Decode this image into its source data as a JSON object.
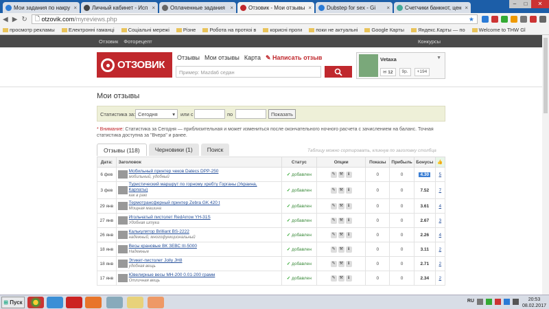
{
  "browser": {
    "tabs": [
      {
        "label": "Мои задания по накру",
        "color": "#2b7bd6",
        "active": false
      },
      {
        "label": "Личный кабинет - Исп",
        "color": "#444",
        "active": false
      },
      {
        "label": "Оплаченные задания",
        "color": "#666",
        "active": false
      },
      {
        "label": "Отзовик - Мои отзывы",
        "color": "#c0282d",
        "active": true
      },
      {
        "label": "Dubstep for sex - Gi",
        "color": "#2b7bd6",
        "active": false
      },
      {
        "label": "Счетчики банкнот, цен",
        "color": "#4a9",
        "active": false
      }
    ],
    "url_host": "otzovik.com",
    "url_path": "/myreviews.php",
    "bookmarks": [
      "просмотр рекламы",
      "Електронні гаманці",
      "Соціальні мережі",
      "Різне",
      "Робота на протязі в",
      "корисні проги",
      "поки не актуальні",
      "Google Карты",
      "Яндекс.Карты — по",
      "Welcome to THW Gl"
    ]
  },
  "site": {
    "topbar": {
      "left": [
        "Отзовик",
        "Фоторецепт"
      ],
      "right": "Конкурсы"
    },
    "logo": "ОТЗОВИК",
    "nav": [
      "Отзывы",
      "Мои отзывы",
      "Карта"
    ],
    "write_review": "Написать отзыв",
    "search_placeholder": "Пример: Mazda6 седан",
    "user": {
      "name": "Vetaxa",
      "messages": "12",
      "rating": "9р.",
      "points": "+194"
    }
  },
  "page": {
    "title": "Мои отзывы",
    "stat_label": "Статистика за:",
    "stat_select": "Сегодня",
    "or_from": "или с",
    "to": "по",
    "show": "Показать",
    "note_warning": "Внимание",
    "note_text": ": Статистика за Сегодня — приблизительная и может измениться после окончательного ночного расчета с зачислением на баланс. Точная статистика доступна за \"Вчера\" и ранее.",
    "tabs": [
      "Отзывы (118)",
      "Черновики (1)",
      "Поиск"
    ],
    "hint": "Таблицу можно сортировать, кликнув по заголовку столбца"
  },
  "table": {
    "headers": [
      "Дата:",
      "Заголовок",
      "Статус",
      "Опции",
      "Показы",
      "Прибыль",
      "Бонусы"
    ],
    "rows": [
      {
        "date": "6 фев",
        "title": "Мобильный принтер чеков Datecs DPP-250",
        "sub": "мобильный, удобный",
        "status": "добавлен",
        "views": "0",
        "profit": "0",
        "bonus": "4.30",
        "rate": "5"
      },
      {
        "date": "3 фев",
        "title": "Туристический маршрут по горному хребту Горганы (Украина, Карпаты)",
        "sub": "как в раю",
        "status": "добавлен",
        "views": "0",
        "profit": "0",
        "bonus": "7.52",
        "rate": "7"
      },
      {
        "date": "29 янв",
        "title": "Термотрансферный принтер Zebra GK 420 t",
        "sub": "Мощная машина",
        "status": "добавлен",
        "views": "0",
        "profit": "0",
        "bonus": "3.61",
        "rate": "4"
      },
      {
        "date": "27 янв",
        "title": "Игольчатый пистолет RedArrow YH-31S",
        "sub": "Удобная штука",
        "status": "добавлен",
        "views": "0",
        "profit": "0",
        "bonus": "2.67",
        "rate": "3"
      },
      {
        "date": "26 янв",
        "title": "Калькулятор Brilliant BS-2222",
        "sub": "надежный, многофункциональный",
        "status": "добавлен",
        "views": "0",
        "profit": "0",
        "bonus": "2.26",
        "rate": "4"
      },
      {
        "date": "18 янв",
        "title": "Весы крановые ВК ЗЕВС III-5000",
        "sub": "Надежные",
        "status": "добавлен",
        "views": "0",
        "profit": "0",
        "bonus": "3.11",
        "rate": "2"
      },
      {
        "date": "18 янв",
        "title": "Этикет-пистолет Jolly JH8",
        "sub": "удобная вещь",
        "status": "добавлен",
        "views": "0",
        "profit": "0",
        "bonus": "2.71",
        "rate": "2"
      },
      {
        "date": "17 янв",
        "title": "Ювелирные весы MH-200 0.01-200 грамм",
        "sub": "Отличная вещь",
        "status": "добавлен",
        "views": "0",
        "profit": "0",
        "bonus": "2.34",
        "rate": "2"
      }
    ]
  },
  "taskbar": {
    "start": "Пуск",
    "lang": "RU",
    "time": "20:53",
    "date": "08.02.2017"
  }
}
